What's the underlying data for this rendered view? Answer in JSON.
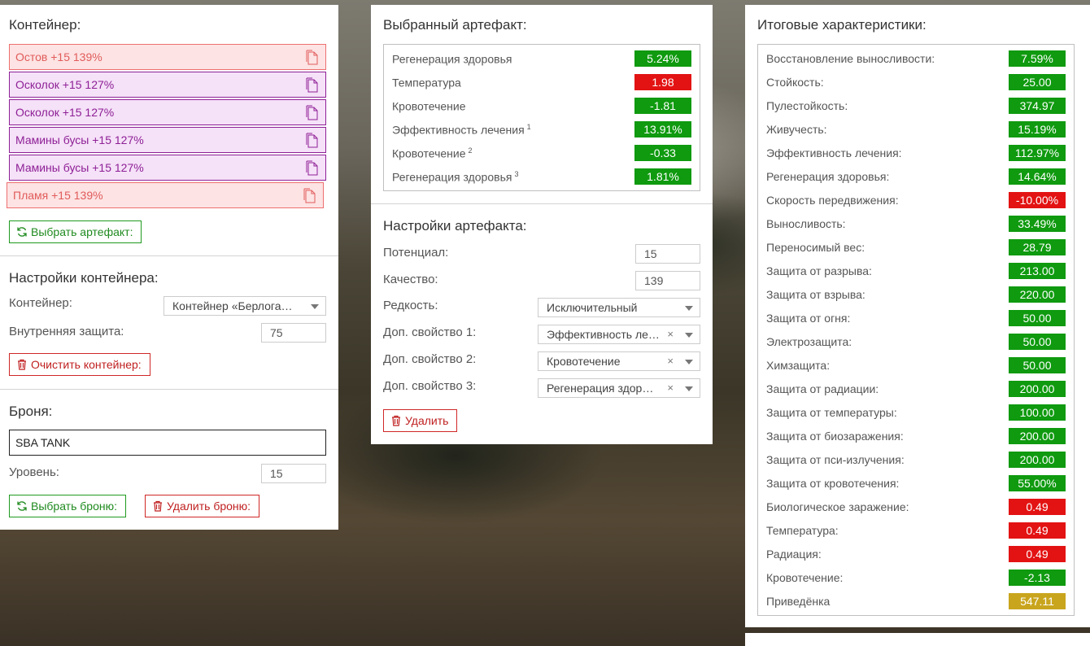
{
  "container": {
    "title": "Контейнер:",
    "items": [
      {
        "label": "Остов +15 139%",
        "color": "red"
      },
      {
        "label": "Осколок +15 127%",
        "color": "purple"
      },
      {
        "label": "Осколок +15 127%",
        "color": "purple"
      },
      {
        "label": "Мамины бусы +15 127%",
        "color": "purple"
      },
      {
        "label": "Мамины бусы +15 127%",
        "color": "purple"
      },
      {
        "label": "Пламя +15 139%",
        "color": "red"
      }
    ],
    "choose_button": "Выбрать артефакт:"
  },
  "container_settings": {
    "title": "Настройки контейнера:",
    "container_label": "Контейнер:",
    "container_value": "Контейнер «Берлога…",
    "protection_label": "Внутренняя защита:",
    "protection_value": "75",
    "clear_button": "Очистить контейнер:"
  },
  "armor": {
    "title": "Броня:",
    "name": "SBA TANK",
    "level_label": "Уровень:",
    "level_value": "15",
    "choose_button": "Выбрать броню:",
    "delete_button": "Удалить броню:"
  },
  "selected_artifact": {
    "title": "Выбранный артефакт:",
    "rows": [
      {
        "name": "Регенерация здоровья",
        "sup": "",
        "value": "5.24%",
        "color": "g"
      },
      {
        "name": "Температура",
        "sup": "",
        "value": "1.98",
        "color": "r"
      },
      {
        "name": "Кровотечение",
        "sup": "",
        "value": "-1.81",
        "color": "g"
      },
      {
        "name": "Эффективность лечения",
        "sup": "1",
        "value": "13.91%",
        "color": "g"
      },
      {
        "name": "Кровотечение",
        "sup": "2",
        "value": "-0.33",
        "color": "g"
      },
      {
        "name": "Регенерация здоровья",
        "sup": "3",
        "value": "1.81%",
        "color": "g"
      }
    ]
  },
  "artifact_settings": {
    "title": "Настройки артефакта:",
    "potential_label": "Потенциал:",
    "potential_value": "15",
    "quality_label": "Качество:",
    "quality_value": "139",
    "rarity_label": "Редкость:",
    "rarity_value": "Исключительный",
    "extra1_label": "Доп. свойство 1:",
    "extra1_value": "Эффективность ле…",
    "extra2_label": "Доп. свойство 2:",
    "extra2_value": "Кровотечение",
    "extra3_label": "Доп. свойство 3:",
    "extra3_value": "Регенерация здор…",
    "clear_x": "×",
    "delete_button": "Удалить"
  },
  "totals": {
    "title": "Итоговые характеристики:",
    "rows": [
      {
        "name": "Восстановление выносливости:",
        "value": "7.59%",
        "color": "g"
      },
      {
        "name": "Стойкость:",
        "value": "25.00",
        "color": "g"
      },
      {
        "name": "Пулестойкость:",
        "value": "374.97",
        "color": "g"
      },
      {
        "name": "Живучесть:",
        "value": "15.19%",
        "color": "g"
      },
      {
        "name": "Эффективность лечения:",
        "value": "112.97%",
        "color": "g"
      },
      {
        "name": "Регенерация здоровья:",
        "value": "14.64%",
        "color": "g"
      },
      {
        "name": "Скорость передвижения:",
        "value": "-10.00%",
        "color": "r"
      },
      {
        "name": "Выносливость:",
        "value": "33.49%",
        "color": "g"
      },
      {
        "name": "Переносимый вес:",
        "value": "28.79",
        "color": "g"
      },
      {
        "name": "Защита от разрыва:",
        "value": "213.00",
        "color": "g"
      },
      {
        "name": "Защита от взрыва:",
        "value": "220.00",
        "color": "g"
      },
      {
        "name": "Защита от огня:",
        "value": "50.00",
        "color": "g"
      },
      {
        "name": "Электрозащита:",
        "value": "50.00",
        "color": "g"
      },
      {
        "name": "Химзащита:",
        "value": "50.00",
        "color": "g"
      },
      {
        "name": "Защита от радиации:",
        "value": "200.00",
        "color": "g"
      },
      {
        "name": "Защита от температуры:",
        "value": "100.00",
        "color": "g"
      },
      {
        "name": "Защита от биозаражения:",
        "value": "200.00",
        "color": "g"
      },
      {
        "name": "Защита от пси-излучения:",
        "value": "200.00",
        "color": "g"
      },
      {
        "name": "Защита от кровотечения:",
        "value": "55.00%",
        "color": "g"
      },
      {
        "name": "Биологическое заражение:",
        "value": "0.49",
        "color": "r"
      },
      {
        "name": "Температура:",
        "value": "0.49",
        "color": "r"
      },
      {
        "name": "Радиация:",
        "value": "0.49",
        "color": "r"
      },
      {
        "name": "Кровотечение:",
        "value": "-2.13",
        "color": "g"
      },
      {
        "name": "Приведёнка",
        "value": "547.11",
        "color": "y"
      }
    ]
  }
}
